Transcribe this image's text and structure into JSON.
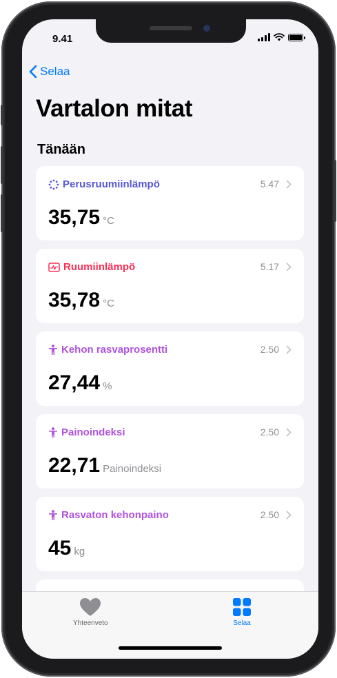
{
  "status": {
    "time": "9.41"
  },
  "nav": {
    "back_label": "Selaa"
  },
  "page": {
    "title": "Vartalon mitat",
    "section": "Tänään"
  },
  "cards": [
    {
      "label": "Perusruumiinlämpö",
      "time": "5.47",
      "value": "35,75",
      "unit": "°C",
      "color": "#5856d6",
      "icon": "sparkle-icon"
    },
    {
      "label": "Ruumiinlämpö",
      "time": "5.17",
      "value": "35,78",
      "unit": "°C",
      "color": "#ff2d55",
      "icon": "thermometer-chart-icon"
    },
    {
      "label": "Kehon rasvaprosentti",
      "time": "2.50",
      "value": "27,44",
      "unit": "%",
      "color": "#af52de",
      "icon": "body-figure-icon"
    },
    {
      "label": "Painoindeksi",
      "time": "2.50",
      "value": "22,71",
      "unit": "Painoindeksi",
      "color": "#af52de",
      "icon": "body-figure-icon"
    },
    {
      "label": "Rasvaton kehonpaino",
      "time": "2.50",
      "value": "45",
      "unit": "kg",
      "color": "#af52de",
      "icon": "body-figure-icon"
    }
  ],
  "tabs": [
    {
      "label": "Yhteenveto",
      "icon": "heart-icon",
      "active": false
    },
    {
      "label": "Selaa",
      "icon": "grid-icon",
      "active": true
    }
  ],
  "colors": {
    "accent": "#007aff",
    "inactive": "#8e8e93"
  }
}
